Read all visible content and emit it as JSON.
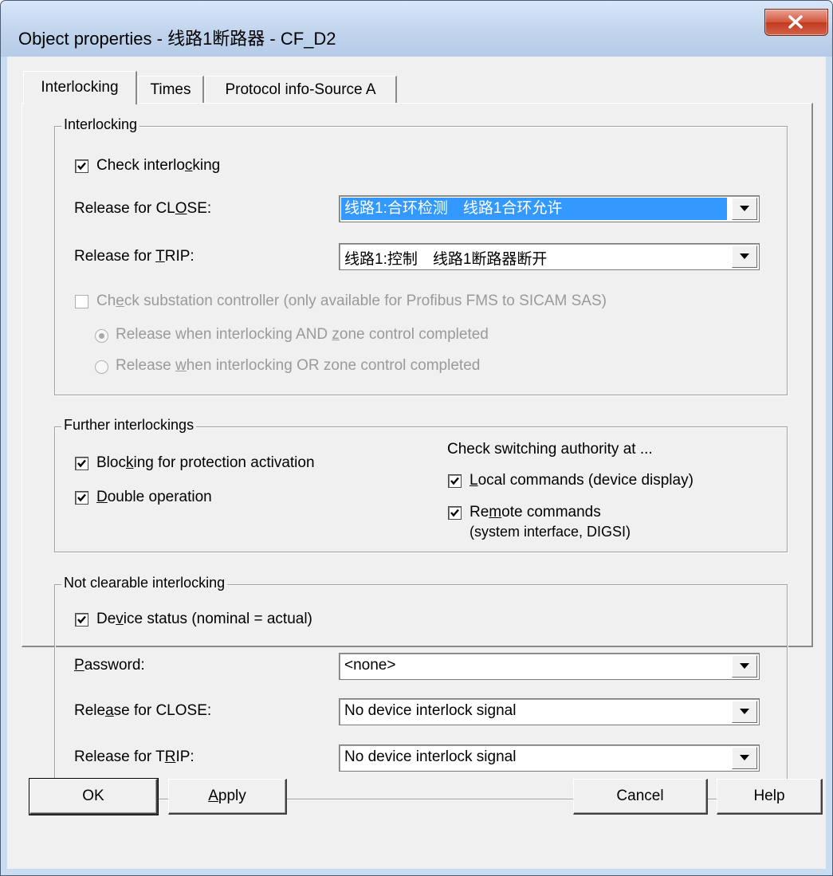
{
  "window": {
    "title": "Object properties - 线路1断路器 - CF_D2"
  },
  "tabs": [
    {
      "label": "Interlocking",
      "active": true
    },
    {
      "label": "Times",
      "active": false
    },
    {
      "label": "Protocol info-Source A",
      "active": false
    }
  ],
  "interlocking": {
    "legend": "Interlocking",
    "check_interlocking": {
      "label_pre": "Check interlo",
      "label_u": "c",
      "label_post": "king",
      "checked": true
    },
    "release_close": {
      "label_pre": "Release for CL",
      "label_u": "O",
      "label_post": "SE:",
      "value": "线路1:合环检测　线路1合环允许"
    },
    "release_trip": {
      "label_pre": "Release for ",
      "label_u": "T",
      "label_post": "RIP:",
      "value": "线路1:控制　线路1断路器断开"
    },
    "substation": {
      "label_pre": "Ch",
      "label_u": "e",
      "label_post": "ck substation controller (only available for Profibus FMS to SICAM SAS)",
      "checked": false
    },
    "radio_and": {
      "label_pre": "Release when interlocking AND ",
      "label_u": "z",
      "label_post": "one control completed",
      "selected": true
    },
    "radio_or": {
      "label_pre": "Release ",
      "label_u": "w",
      "label_post": "hen interlocking OR zone control completed",
      "selected": false
    }
  },
  "further": {
    "legend": "Further interlockings",
    "blocking": {
      "label_pre": "Bloc",
      "label_u": "k",
      "label_post": "ing for protection activation",
      "checked": true
    },
    "double": {
      "label_pre": "",
      "label_u": "D",
      "label_post": "ouble operation",
      "checked": true
    },
    "authority_heading": "Check switching authority at ...",
    "local": {
      "label_pre": "",
      "label_u": "L",
      "label_post": "ocal commands (device display)",
      "checked": true
    },
    "remote": {
      "label_pre": "Re",
      "label_u": "m",
      "label_post": "ote commands",
      "line2": "(system interface, DIGSI)",
      "checked": true
    }
  },
  "not_clearable": {
    "legend": "Not clearable interlocking",
    "device_status": {
      "label_pre": "De",
      "label_u": "v",
      "label_post": "ice status (nominal = actual)",
      "checked": true
    },
    "password": {
      "label_pre": "",
      "label_u": "P",
      "label_post": "assword:",
      "value": "<none>"
    },
    "release_close": {
      "label_pre": "Rele",
      "label_u": "a",
      "label_post": "se for CLOSE:",
      "value": "No device interlock signal"
    },
    "release_trip": {
      "label_pre": "Release for T",
      "label_u": "R",
      "label_post": "IP:",
      "value": "No device interlock signal"
    }
  },
  "buttons": {
    "ok": {
      "label": "OK"
    },
    "apply": {
      "label_pre": "",
      "label_u": "A",
      "label_post": "pply"
    },
    "cancel": {
      "label": "Cancel"
    },
    "help": {
      "label": "Help"
    }
  }
}
